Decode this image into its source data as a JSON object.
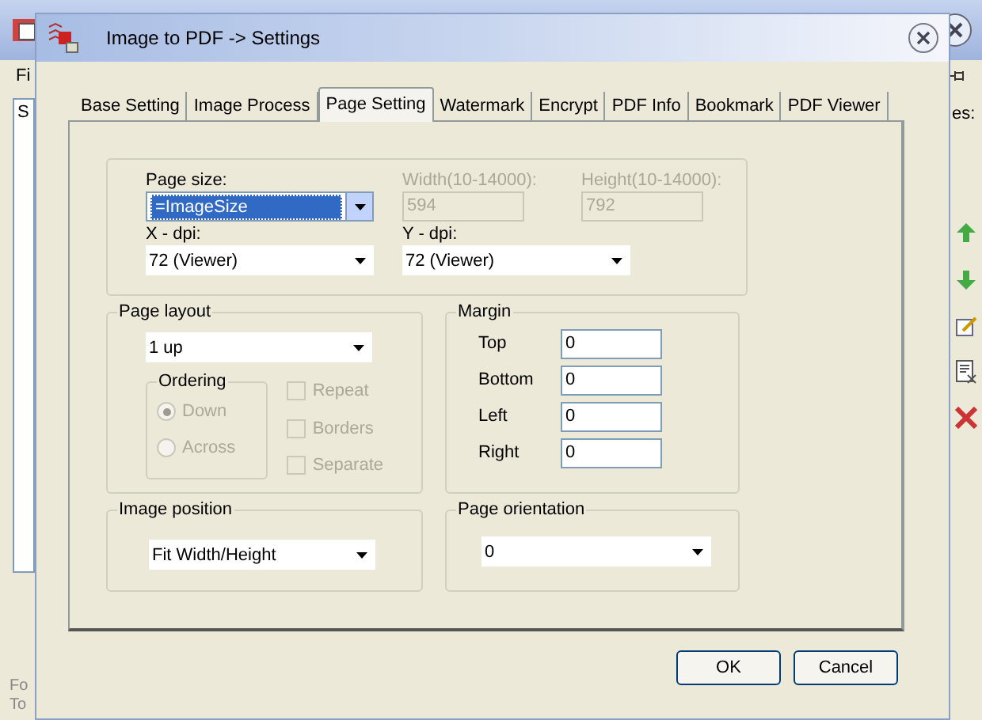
{
  "background_window": {
    "menu_text": "Fi",
    "list_text": "S",
    "side_label": "es:",
    "footer_texts": [
      "Fo",
      "To"
    ]
  },
  "dialog": {
    "title": "Image to PDF -> Settings",
    "tabs": [
      {
        "label": "Base Setting",
        "selected": false
      },
      {
        "label": "Image Process",
        "selected": false
      },
      {
        "label": "Page Setting",
        "selected": true
      },
      {
        "label": "Watermark",
        "selected": false
      },
      {
        "label": "Encrypt",
        "selected": false
      },
      {
        "label": "PDF Info",
        "selected": false
      },
      {
        "label": "Bookmark",
        "selected": false
      },
      {
        "label": "PDF Viewer",
        "selected": false
      }
    ],
    "page_size": {
      "label": "Page size:",
      "value": "=ImageSize",
      "focused": true
    },
    "width": {
      "label": "Width(10-14000):",
      "value": "594",
      "disabled": true
    },
    "height": {
      "label": "Height(10-14000):",
      "value": "792",
      "disabled": true
    },
    "x_dpi": {
      "label": "X - dpi:",
      "value": "72 (Viewer)"
    },
    "y_dpi": {
      "label": "Y - dpi:",
      "value": "72 (Viewer)"
    },
    "page_layout": {
      "title": "Page layout",
      "value": "1 up",
      "ordering_title": "Ordering",
      "ordering": [
        {
          "label": "Down",
          "selected": true,
          "disabled": true
        },
        {
          "label": "Across",
          "selected": false,
          "disabled": true
        }
      ],
      "options": [
        {
          "label": "Repeat",
          "checked": false,
          "disabled": true
        },
        {
          "label": "Borders",
          "checked": false,
          "disabled": true
        },
        {
          "label": "Separate",
          "checked": false,
          "disabled": true
        }
      ]
    },
    "margin": {
      "title": "Margin",
      "fields": [
        {
          "label": "Top",
          "value": "0"
        },
        {
          "label": "Bottom",
          "value": "0"
        },
        {
          "label": "Left",
          "value": "0"
        },
        {
          "label": "Right",
          "value": "0"
        }
      ]
    },
    "image_position": {
      "title": "Image position",
      "value": "Fit Width/Height"
    },
    "page_orientation": {
      "title": "Page orientation",
      "value": "0"
    },
    "buttons": [
      "OK",
      "Cancel"
    ]
  }
}
